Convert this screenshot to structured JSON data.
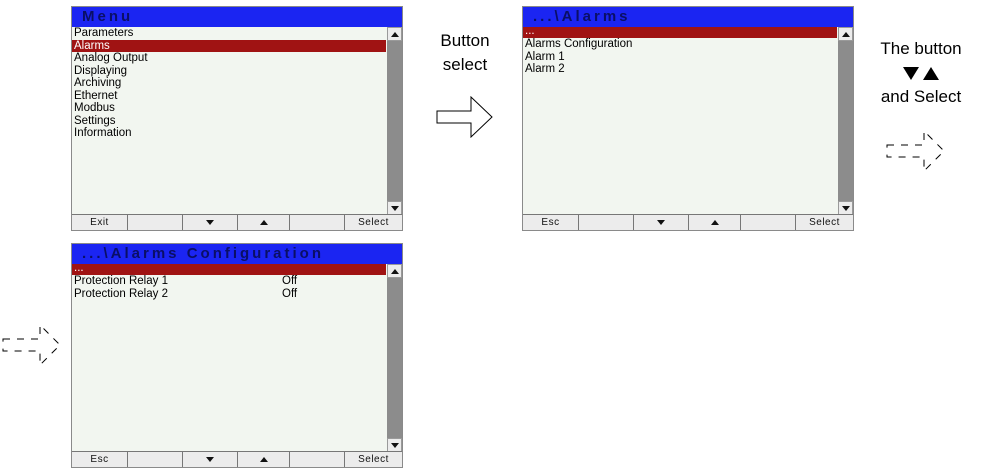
{
  "screens": [
    {
      "title": "Menu",
      "items": [
        {
          "label": "Parameters"
        },
        {
          "label": "Alarms",
          "selected": true
        },
        {
          "label": "Analog Output"
        },
        {
          "label": "Displaying"
        },
        {
          "label": "Archiving"
        },
        {
          "label": "Ethernet"
        },
        {
          "label": "Modbus"
        },
        {
          "label": "Settings"
        },
        {
          "label": "Information"
        }
      ],
      "keys": [
        "Exit",
        "",
        "down-icon",
        "up-icon",
        "",
        "Select"
      ]
    },
    {
      "title": "...\\Alarms",
      "items": [
        {
          "label": "...",
          "selected": true
        },
        {
          "label": "Alarms Configuration"
        },
        {
          "label": "Alarm 1"
        },
        {
          "label": "Alarm 2"
        }
      ],
      "keys": [
        "Esc",
        "",
        "down-icon",
        "up-icon",
        "",
        "Select"
      ]
    },
    {
      "title": "...\\Alarms Configuration",
      "items": [
        {
          "label": "...",
          "selected": true
        },
        {
          "label": "Protection Relay 1",
          "value": "Off"
        },
        {
          "label": "Protection Relay 2",
          "value": "Off"
        }
      ],
      "keys": [
        "Esc",
        "",
        "down-icon",
        "up-icon",
        "",
        "Select"
      ]
    }
  ],
  "captions": {
    "button_select": [
      "Button",
      "select"
    ],
    "the_button": "The button",
    "and_select": "and Select"
  },
  "colors": {
    "titlebar": "#1b25f2",
    "title_text": "#0a0f66",
    "selection": "#a01313",
    "screen_bg": "#f2f6f0"
  }
}
